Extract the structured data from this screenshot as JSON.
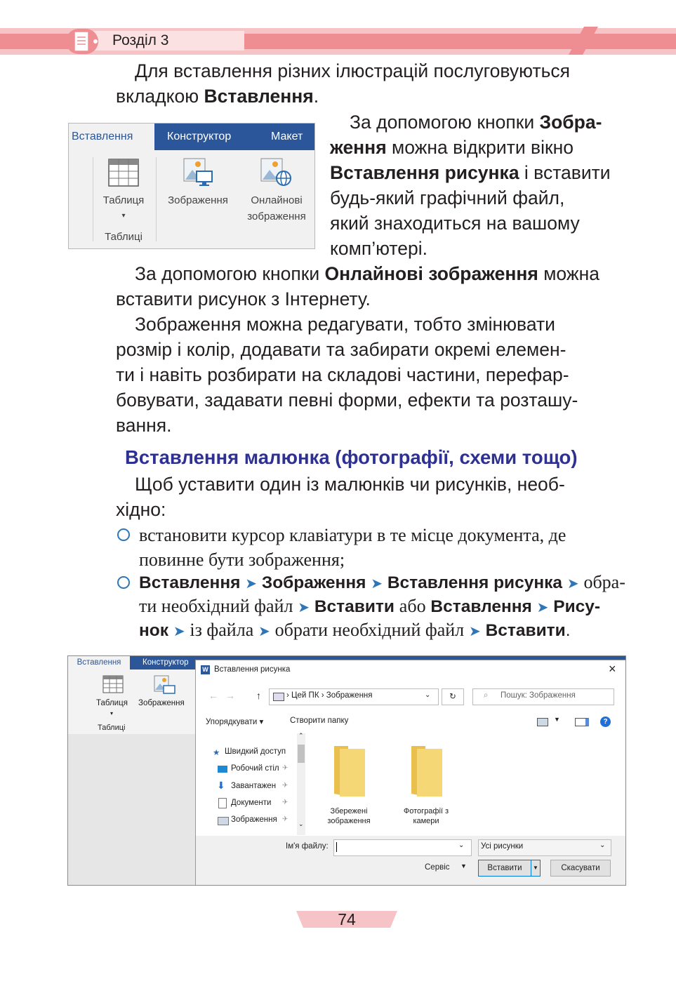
{
  "header": {
    "section": "Розділ 3"
  },
  "intro": {
    "line1": "Для вставлення різних ілюстрацій послуговуються",
    "line2_pre": "вкладкою ",
    "line2_bold": "Вставлення",
    "line2_post": "."
  },
  "ribbon": {
    "tabs": [
      "Вставлення",
      "Конструктор",
      "Макет"
    ],
    "table_label": "Таблиця",
    "group_label": "Таблиці",
    "picture_label": "Зображення",
    "online_label_1": "Онлайнові",
    "online_label_2": "зображення"
  },
  "para1": {
    "l1_pre": "За допомогою кнопки ",
    "l1_bold": "Зобра-",
    "l2_bold": "ження",
    "l2_post": " можна відкрити вікно",
    "l3_bold": "Вставлення рисунка",
    "l3_post": " і вставити",
    "l4": "будь-який графічний файл,",
    "l5": "який знаходиться на вашому",
    "l6": "комп’ютері."
  },
  "para2": {
    "l1_pre": "За допомогою кнопки ",
    "l1_bold": "Онлайнові зображення",
    "l1_post": " можна",
    "l2": "вставити рисунок з Інтернету."
  },
  "para3": {
    "l1": "Зображення можна редагувати, тобто змінювати",
    "l2": "розмір і колір, додавати та забирати окремі елемен-",
    "l3": "ти і навіть розбирати на складові частини, перефар-",
    "l4": "бовувати, задавати певні форми, ефекти та розташу-",
    "l5": "вання."
  },
  "heading": "Вставлення малюнка (фотографії, схеми тощо)",
  "para4": {
    "l1": "Щоб уставити один із малюнків чи рисунків, необ-",
    "l2": "хідно:"
  },
  "bullet1": {
    "l1": "встановити курсор клавіатури в те місце документа, де",
    "l2": "повинне бути зображення;"
  },
  "bullet2": {
    "s1": "Вставлення",
    "s2": "Зображення",
    "s3": "Вставлення рисунка",
    "t1": "обра-",
    "t2": "ти необхідний файл",
    "s4": "Вставити",
    "t3": "або",
    "s5": "Вставлення",
    "s6": "Рису-",
    "s7": "нок",
    "t4": "із файла",
    "t5": "обрати необхідний файл",
    "s8": "Вставити",
    "t6": "."
  },
  "screenshot": {
    "word_tabs": [
      "Вставлення",
      "Конструктор"
    ],
    "word_table": "Таблиця",
    "word_group": "Таблиці",
    "word_picture": "Зображення",
    "dialog_title": "Вставлення рисунка",
    "path_1": "Цей ПК",
    "path_2": "Зображення",
    "search_placeholder": "Пошук: Зображення",
    "organize": "Упорядкувати ▾",
    "new_folder": "Створити папку",
    "nav": [
      "Швидкий доступ",
      "Робочий стіл",
      "Завантажен",
      "Документи",
      "Зображення"
    ],
    "folder1_l1": "Збережені",
    "folder1_l2": "зображення",
    "folder2_l1": "Фотографії з",
    "folder2_l2": "камери",
    "filename_label": "Ім'я файлу:",
    "filter": "Усі рисунки",
    "tools": "Сервіс",
    "insert": "Вставити",
    "cancel": "Скасувати"
  },
  "page_number": "74"
}
